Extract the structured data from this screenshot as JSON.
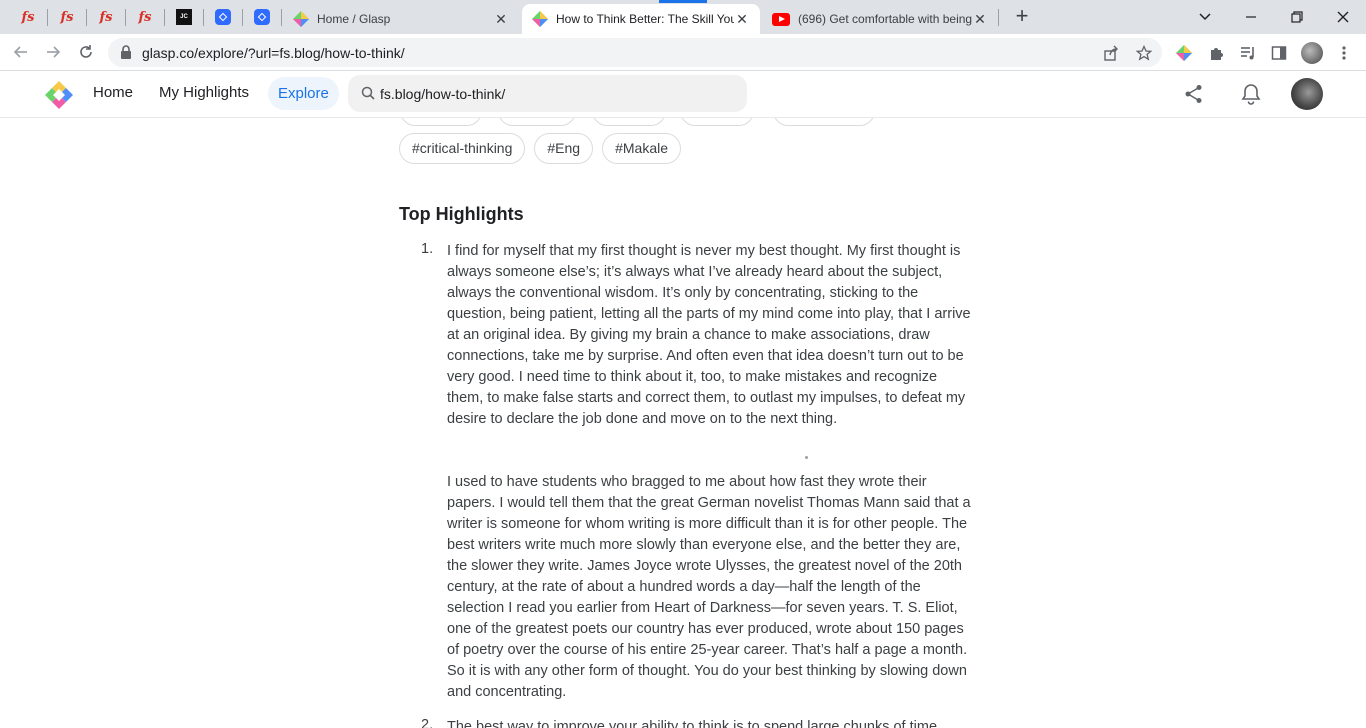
{
  "browser": {
    "pinned_tabs": [
      {
        "icon": "fs-favicon",
        "glyph": "fs"
      },
      {
        "icon": "fs-favicon",
        "glyph": "fs"
      },
      {
        "icon": "fs-favicon",
        "glyph": "fs"
      },
      {
        "icon": "fs-favicon",
        "glyph": "fs"
      },
      {
        "icon": "jc-favicon",
        "glyph": "JC"
      },
      {
        "icon": "blue-diamond-favicon",
        "glyph": ""
      },
      {
        "icon": "blue-diamond-favicon",
        "glyph": ""
      }
    ],
    "tabs": [
      {
        "title": "Home / Glasp",
        "icon": "glasp-favicon",
        "active": false
      },
      {
        "title": "How to Think Better: The Skill You",
        "icon": "glasp-favicon",
        "active": true
      },
      {
        "title": "(696) Get comfortable with being",
        "icon": "youtube-favicon",
        "active": false
      }
    ],
    "new_tab_label": "+",
    "url": "glasp.co/explore/?url=fs.blog/how-to-think/"
  },
  "app": {
    "nav": {
      "home": "Home",
      "my_highlights": "My Highlights",
      "explore": "Explore"
    },
    "search_value": "fs.blog/how-to-think/",
    "colors": {
      "accent": "#1a73e8",
      "explore_pill_bg": "#eef4fb"
    }
  },
  "content": {
    "tags": [
      "#critical-thinking",
      "#Eng",
      "#Makale"
    ],
    "section_title": "Top Highlights",
    "highlights": [
      {
        "number": "1.",
        "paragraphs": [
          "I find for myself that my first thought is never my best thought. My first thought is always someone else’s; it’s always what I’ve already heard about the subject, always the conventional wisdom. It’s only by concentrating, sticking to the question, being patient, letting all the parts of my mind come into play, that I arrive at an original idea. By giving my brain a chance to make associations, draw connections, take me by surprise. And often even that idea doesn’t turn out to be very good. I need time to think about it, too, to make mistakes and recognize them, to make false starts and correct them, to outlast my impulses, to defeat my desire to declare the job done and move on to the next thing.",
          "I used to have students who bragged to me about how fast they wrote their papers. I would tell them that the great German novelist Thomas Mann said that a writer is someone for whom writing is more difficult than it is for other people. The best writers write much more slowly than everyone else, and the better they are, the slower they write. James Joyce wrote Ulysses, the greatest novel of the 20th century, at the rate of about a hundred words a day—half the length of the selection I read you earlier from Heart of Darkness—for seven years. T. S. Eliot, one of the greatest poets our country has ever produced, wrote about 150 pages of poetry over the course of his entire 25-year career. That’s half a page a month. So it is with any other form of thought. You do your best thinking by slowing down and concentrating."
        ]
      },
      {
        "number": "2.",
        "paragraphs": [
          "The best way to improve your ability to think is to spend large chunks of time"
        ]
      }
    ]
  }
}
